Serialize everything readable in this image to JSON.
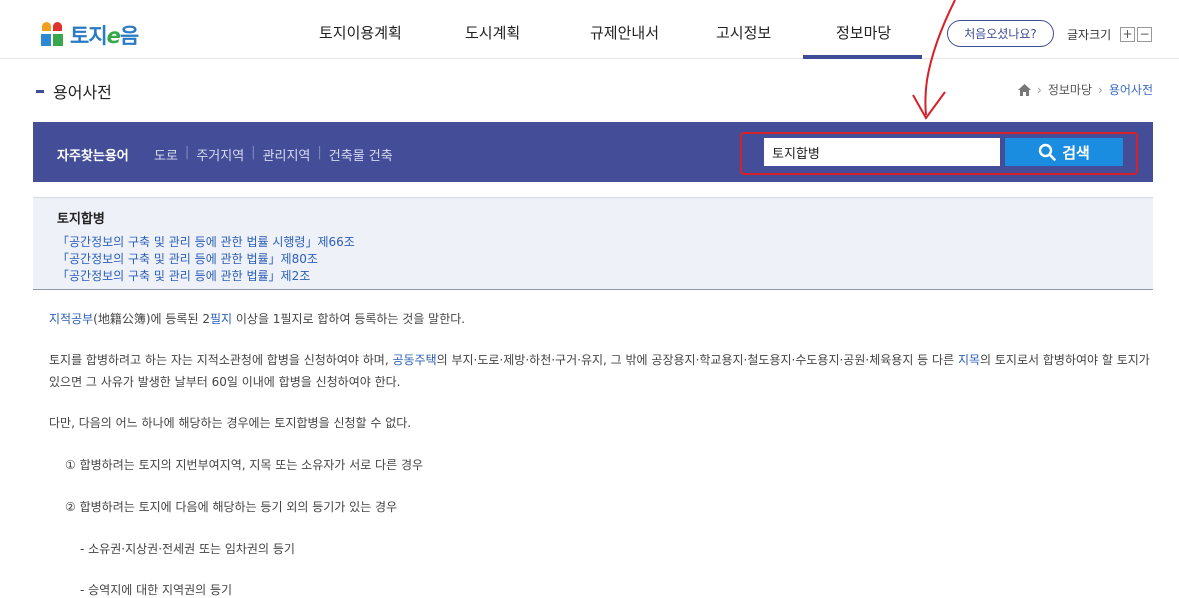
{
  "header": {
    "logo_text_1": "토지",
    "logo_text_e": "e",
    "logo_text_2": "음",
    "nav": [
      "토지이용계획",
      "도시계획",
      "규제안내서",
      "고시정보",
      "정보마당"
    ],
    "active_nav": "정보마당",
    "first_visit_label": "처음오셨나요?",
    "font_size_label": "글자크기",
    "font_plus": "+",
    "font_minus": "−"
  },
  "page": {
    "title": "용어사전",
    "breadcrumb": [
      "정보마당",
      "용어사전"
    ]
  },
  "search": {
    "freq_label": "자주찾는용어",
    "freq_terms": [
      "도로",
      "주거지역",
      "관리지역",
      "건축물 건축"
    ],
    "input_value": "토지합병",
    "button_label": "검색"
  },
  "term": {
    "title": "토지합병",
    "laws": [
      "「공간정보의 구축 및 관리 등에 관한 법률 시행령」제66조",
      "「공간정보의 구축 및 관리 등에 관한 법률」제80조",
      "「공간정보의 구축 및 관리 등에 관한 법률」제2조"
    ]
  },
  "content": {
    "p1_link1": "지적공부",
    "p1_a": "(地籍公簿)에 등록된 2",
    "p1_link2": "필지",
    "p1_b": " 이상을 1필지로 합하여 등록하는 것을 말한다.",
    "p2_a": "토지를 합병하려고 하는 자는 지적소관청에 합병을 신청하여야 하며, ",
    "p2_link1": "공동주택",
    "p2_b": "의 부지·도로·제방·하천·구거·유지, 그 밖에 공장용지·학교용지·철도용지·수도용지·공원·체육용지 등 다른 ",
    "p2_link2": "지목",
    "p2_c": "의 토지로서 합병하여야 할 토지가",
    "p2_line2": "있으면 그 사유가 발생한 날부터 60일 이내에 합병을 신청하여야 한다.",
    "p3": "다만, 다음의 어느 하나에 해당하는 경우에는 토지합병을 신청할 수 없다.",
    "item1": "① 합병하려는 토지의 지번부여지역, 지목 또는 소유자가 서로 다른 경우",
    "item2": "② 합병하려는 토지에 다음에 해당하는 등기 외의 등기가 있는 경우",
    "sub1": "- 소유권·지상권·전세권 또는 임차권의 등기",
    "sub2": "- 승역지에 대한 지역권의 등기"
  }
}
